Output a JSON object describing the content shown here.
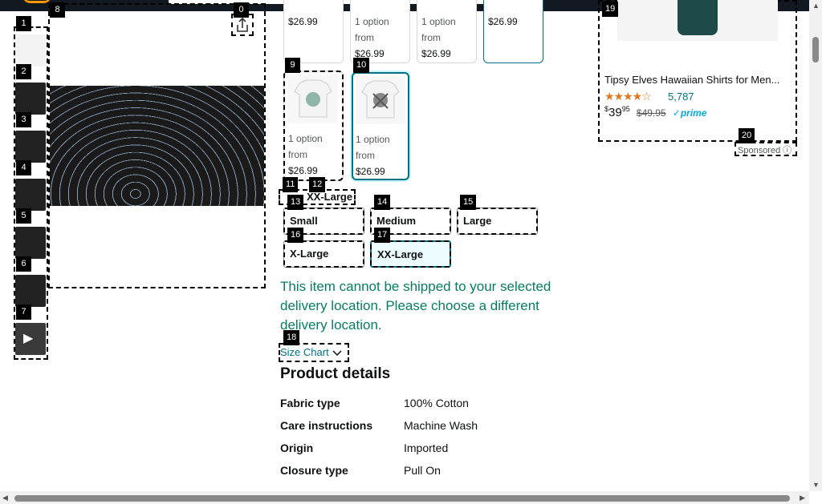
{
  "header": {},
  "gallery": {
    "thumbnails": [
      "1",
      "2",
      "3",
      "4",
      "5",
      "6",
      "7"
    ],
    "labels": {
      "share": "0",
      "main": "8"
    }
  },
  "styles": {
    "top_tiles": [
      {
        "line1": "",
        "line2": "",
        "price": "$26.99"
      },
      {
        "line1": "1 option",
        "line2": "from",
        "price": "$26.99"
      },
      {
        "line1": "1 option",
        "line2": "from",
        "price": "$26.99"
      },
      {
        "line1": "",
        "line2": "",
        "price": "$26.99"
      }
    ],
    "tile9": {
      "tag": "9",
      "line1": "1 option",
      "line2": "from",
      "price": "$26.99"
    },
    "tile10": {
      "tag": "10",
      "line1": "1 option",
      "line2": "from",
      "price": "$26.99"
    }
  },
  "size": {
    "tag11": "11",
    "tag12": "12",
    "selected_label": "XX-Large",
    "options": [
      {
        "tag": "13",
        "label": "Small"
      },
      {
        "tag": "14",
        "label": "Medium"
      },
      {
        "tag": "15",
        "label": "Large"
      },
      {
        "tag": "16",
        "label": "X-Large"
      },
      {
        "tag": "17",
        "label": "XX-Large"
      }
    ]
  },
  "shipping_warning": "This item cannot be shipped to your selected delivery location. Please choose a different delivery location.",
  "size_chart": {
    "tag": "18",
    "label": "Size Chart"
  },
  "product_details": {
    "title": "Product details",
    "rows": [
      {
        "k": "Fabric type",
        "v": "100% Cotton"
      },
      {
        "k": "Care instructions",
        "v": "Machine Wash"
      },
      {
        "k": "Origin",
        "v": "Imported"
      },
      {
        "k": "Closure type",
        "v": "Pull On"
      }
    ]
  },
  "ad": {
    "tag": "19",
    "title": "Tipsy Elves Hawaiian Shirts for Men...",
    "stars": "★★★★☆",
    "rating_count": "5,787",
    "price_dollars": "39",
    "price_cents": "95",
    "old_price": "$49.95",
    "prime": "✓prime",
    "sponsored_tag": "20",
    "sponsored": "Sponsored ⓘ"
  },
  "colors": {
    "accent": "#007185",
    "warning": "#067d62",
    "amazon_orange": "#ff9900"
  }
}
